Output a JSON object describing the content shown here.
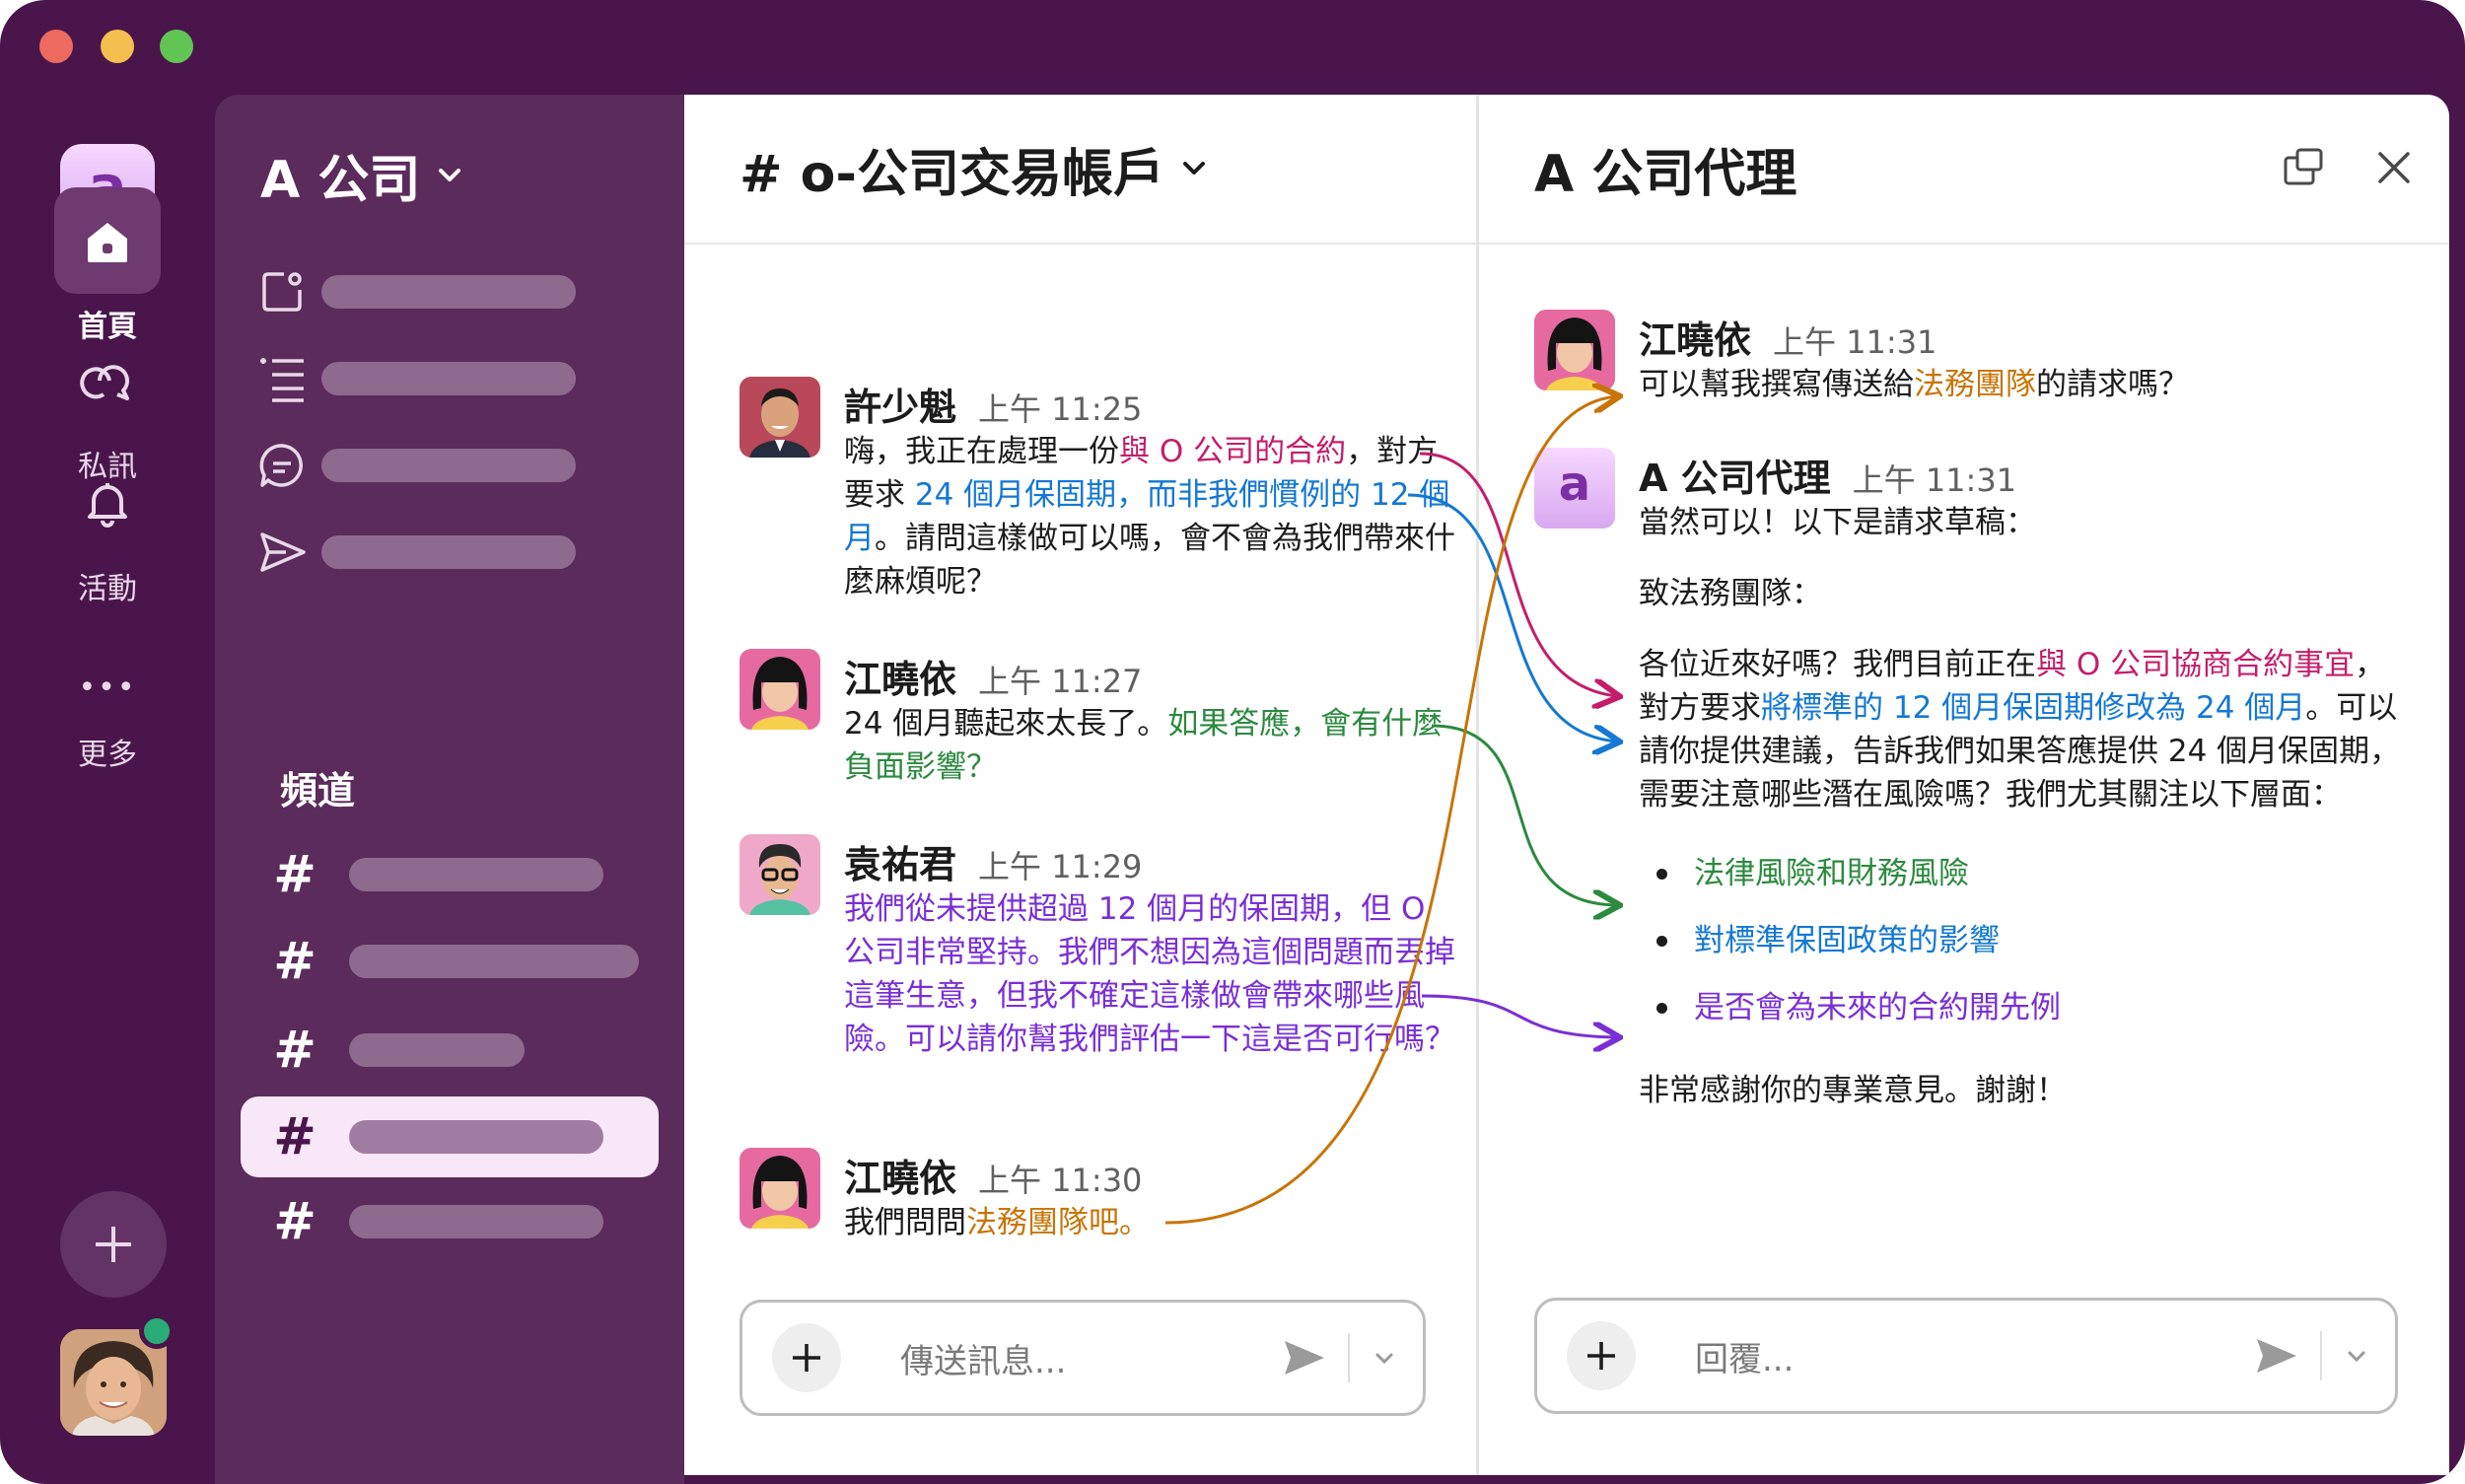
{
  "workspace": {
    "logo_letter": "a",
    "name": "A 公司"
  },
  "rail": {
    "items": [
      {
        "label": "首頁",
        "icon": "home-icon",
        "active": true
      },
      {
        "label": "私訊",
        "icon": "dm-icon"
      },
      {
        "label": "活動",
        "icon": "bell-icon"
      },
      {
        "label": "更多",
        "icon": "more-icon",
        "glyph": "•••"
      }
    ]
  },
  "sidebar": {
    "channels_title": "頻道",
    "channel_hash": "#"
  },
  "channel": {
    "title": "# o-公司交易帳戶",
    "messages": [
      {
        "author": "許少魁",
        "time": "上午 11:25",
        "parts": [
          {
            "t": "嗨，我正在處理一份"
          },
          {
            "t": "與 O 公司的合約",
            "c": "red"
          },
          {
            "t": "，對方要求 "
          },
          {
            "t": "24 個月保固期，而非我們慣例的 12 個月",
            "c": "blue"
          },
          {
            "t": "。請問這樣做可以嗎，會不會為我們帶來什麼麻煩呢？"
          }
        ]
      },
      {
        "author": "江曉依",
        "time": "上午 11:27",
        "parts": [
          {
            "t": "24 個月聽起來太長了。"
          },
          {
            "t": "如果答應，會有什麼負面影響？",
            "c": "green"
          }
        ]
      },
      {
        "author": "袁祐君",
        "time": "上午 11:29",
        "parts": [
          {
            "t": "我們從未提供超過 12 個月的保固期，但 O 公司非常堅持。我們不想因為這個問題而丟掉這筆生意，但我不確定這樣做會帶來哪些風險。可以請你幫我們評估一下這是否可行嗎？",
            "c": "purple"
          }
        ]
      },
      {
        "author": "江曉依",
        "time": "上午 11:30",
        "parts": [
          {
            "t": "我們問問"
          },
          {
            "t": "法務團隊吧。",
            "c": "orange"
          }
        ]
      }
    ],
    "composer_placeholder": "傳送訊息..."
  },
  "thread": {
    "title": "A 公司代理",
    "messages": [
      {
        "author": "江曉依",
        "time": "上午 11:31",
        "parts": [
          {
            "t": "可以幫我撰寫傳送給"
          },
          {
            "t": "法務團隊",
            "c": "orange"
          },
          {
            "t": "的請求嗎？"
          }
        ]
      },
      {
        "author": "A 公司代理",
        "time": "上午 11:31",
        "intro": "當然可以！以下是請求草稿：",
        "greeting": "致法務團隊：",
        "body_parts": [
          {
            "t": "各位近來好嗎？我們目前正在"
          },
          {
            "t": "與 O 公司協商合約事宜",
            "c": "red"
          },
          {
            "t": "，對方要求"
          },
          {
            "t": "將標準的 12 個月保固期修改為 24 個月",
            "c": "blue"
          },
          {
            "t": "。可以請你提供建議，告訴我們如果答應提供 24 個月保固期，需要注意哪些潛在風險嗎？我們尤其關注以下層面："
          }
        ],
        "bullets": [
          {
            "t": "法律風險和財務風險",
            "c": "green"
          },
          {
            "t": "對標準保固政策的影響",
            "c": "blue"
          },
          {
            "t": "是否會為未來的合約開先例",
            "c": "purple"
          }
        ],
        "closing": "非常感謝你的專業意見。謝謝！"
      }
    ],
    "composer_placeholder": "回覆..."
  },
  "colors": {
    "red": "#c41e6a",
    "blue": "#1478d4",
    "green": "#2b8a3e",
    "purple": "#7a2fd6",
    "orange": "#c87406",
    "aubergine": "#4a154b"
  }
}
